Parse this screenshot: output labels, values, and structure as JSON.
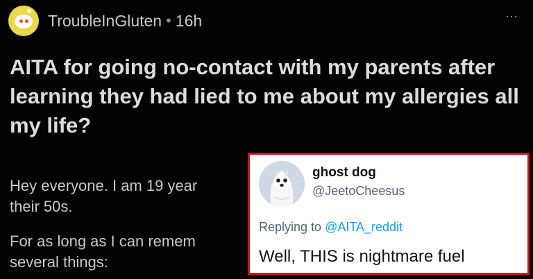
{
  "post": {
    "username": "TroubleInGluten",
    "separator": "•",
    "age": "16h",
    "more_icon": "⋯",
    "title": "AITA for going no-contact with my parents after learning they had lied to me about my allergies all my life?",
    "body": [
      "Hey everyone. I am 19 year",
      "their 50s.",
      "For as long as I can remem",
      "several things:"
    ]
  },
  "tweet": {
    "display_name": "ghost dog",
    "handle": "@JeetoCheesus",
    "replying_prefix": "Replying to ",
    "replying_mention": "@AITA_reddit",
    "text": "Well, THIS is nightmare fuel"
  },
  "colors": {
    "background": "#030303",
    "card_border": "#d41414",
    "mention": "#1d9bf0",
    "avatar_bg": "#e8d84a"
  },
  "icons": {
    "reddit_avatar": "snoo-avatar-icon",
    "more": "more-options-icon",
    "tweet_avatar": "ghost-dog-avatar-icon"
  }
}
